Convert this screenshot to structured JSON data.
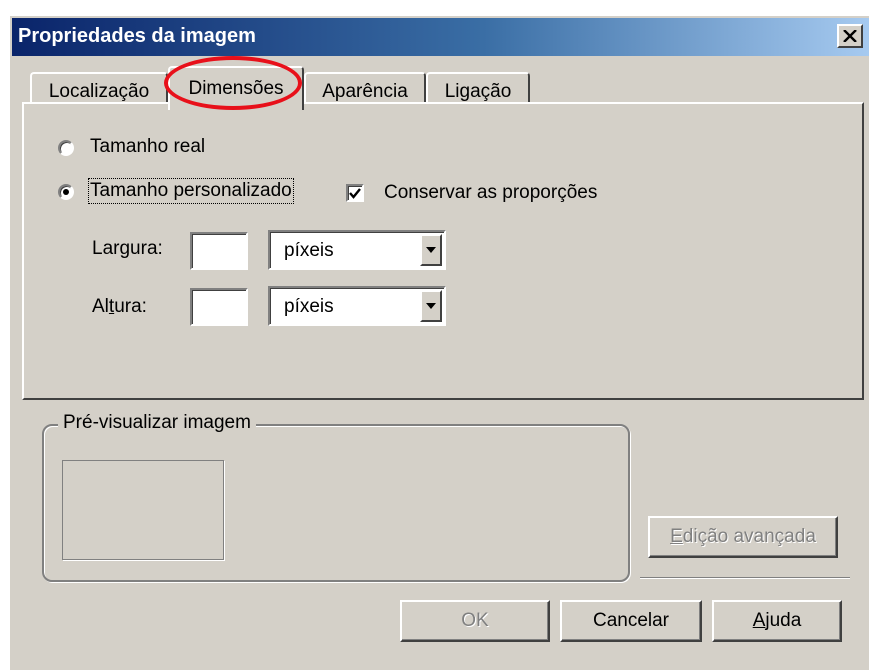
{
  "window": {
    "title": "Propriedades da imagem",
    "close_label": "×"
  },
  "tabs": [
    {
      "label": "Localização",
      "active": false
    },
    {
      "label": "Dimensões",
      "active": true
    },
    {
      "label": "Aparência",
      "active": false
    },
    {
      "label": "Ligação",
      "active": false
    }
  ],
  "size_options": {
    "real": {
      "label": "Tamanho real",
      "selected": false
    },
    "custom": {
      "label": "Tamanho personalizado",
      "selected": true
    },
    "keep_proportions": {
      "label": "Conservar as proporções",
      "checked": true
    }
  },
  "dimensions": {
    "width": {
      "label_pre": "Lar",
      "label_mnemonic": "g",
      "label_post": "ura:",
      "value": "",
      "unit": "píxeis"
    },
    "height": {
      "label_pre": "Al",
      "label_mnemonic": "t",
      "label_post": "ura:",
      "value": "",
      "unit": "píxeis"
    }
  },
  "preview": {
    "legend": "Pré-visualizar imagem"
  },
  "buttons": {
    "advanced_edit": {
      "label_pre": "",
      "label_mnemonic": "E",
      "label_post": "dição avançada",
      "enabled": false
    },
    "ok": {
      "label": "OK",
      "enabled": false
    },
    "cancel": {
      "label": "Cancelar",
      "enabled": true
    },
    "help": {
      "label_pre": "",
      "label_mnemonic": "A",
      "label_post": "juda",
      "enabled": true
    }
  },
  "colors": {
    "titlebar_start": "#0a246a",
    "titlebar_end": "#a6caf0",
    "face": "#d4d0c8",
    "highlight_annotation": "#e8101a"
  }
}
